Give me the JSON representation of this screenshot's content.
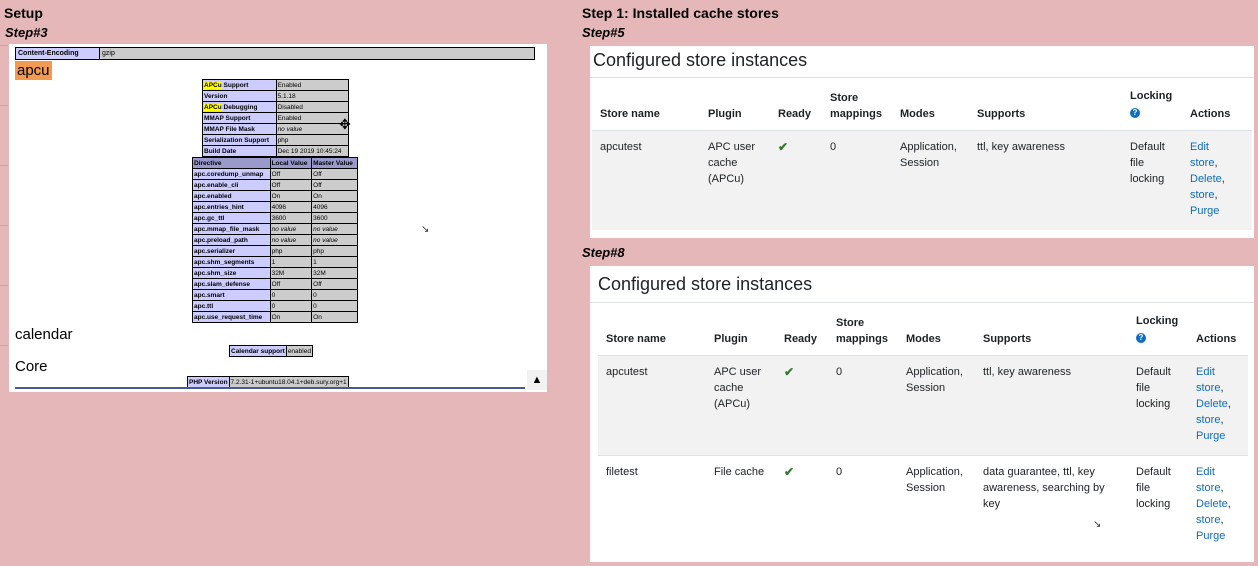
{
  "headings": {
    "setup": "Setup",
    "step1": "Step 1: Installed cache stores"
  },
  "steps": {
    "left": "Step#3",
    "right_top": "Step#5",
    "right_bottom": "Step#8"
  },
  "phpinfo": {
    "content_encoding": {
      "label": "Content-Encoding",
      "value": "gzip"
    },
    "apcu_title": "apcu",
    "apcu_info": [
      {
        "hl": "APCu",
        "rest": " Support",
        "value": "Enabled"
      },
      {
        "hl": "",
        "rest": "Version",
        "value": "5.1.18"
      },
      {
        "hl": "APCu",
        "rest": " Debugging",
        "value": "Disabled"
      },
      {
        "hl": "",
        "rest": "MMAP Support",
        "value": "Enabled"
      },
      {
        "hl": "",
        "rest": "MMAP File Mask",
        "value": "no value",
        "italic": true
      },
      {
        "hl": "",
        "rest": "Serialization Support",
        "value": "php"
      },
      {
        "hl": "",
        "rest": "Build Date",
        "value": "Dec 19 2019 10:45:24"
      }
    ],
    "directive_headers": [
      "Directive",
      "Local Value",
      "Master Value"
    ],
    "directives": [
      [
        "apc.coredump_unmap",
        "Off",
        "Off"
      ],
      [
        "apc.enable_cli",
        "Off",
        "Off"
      ],
      [
        "apc.enabled",
        "On",
        "On"
      ],
      [
        "apc.entries_hint",
        "4096",
        "4096"
      ],
      [
        "apc.gc_ttl",
        "3600",
        "3600"
      ],
      [
        "apc.mmap_file_mask",
        "no value",
        "no value"
      ],
      [
        "apc.preload_path",
        "no value",
        "no value"
      ],
      [
        "apc.serializer",
        "php",
        "php"
      ],
      [
        "apc.shm_segments",
        "1",
        "1"
      ],
      [
        "apc.shm_size",
        "32M",
        "32M"
      ],
      [
        "apc.slam_defense",
        "Off",
        "Off"
      ],
      [
        "apc.smart",
        "0",
        "0"
      ],
      [
        "apc.ttl",
        "0",
        "0"
      ],
      [
        "apc.use_request_time",
        "On",
        "On"
      ]
    ],
    "calendar_title": "calendar",
    "calendar_support": {
      "label": "Calendar support",
      "value": "enabled"
    },
    "core_title": "Core",
    "php_version": {
      "label": "PHP Version",
      "value": "7.2.31-1+ubuntu18.04.1+deb.sury.org+1"
    },
    "scroll_icon": "arrow-up-icon"
  },
  "stores_step5": {
    "title": "Configured store instances",
    "headers": {
      "store_name": "Store name",
      "plugin": "Plugin",
      "ready": "Ready",
      "mappings_1": "Store",
      "mappings_2": "mappings",
      "modes": "Modes",
      "supports": "Supports",
      "locking": "Locking",
      "actions": "Actions"
    },
    "rows": [
      {
        "name": "apcutest",
        "plugin": [
          "APC user",
          "cache",
          "(APCu)"
        ],
        "mappings": "0",
        "modes": [
          "Application,",
          "Session"
        ],
        "supports": [
          "ttl, key awareness"
        ],
        "locking": [
          "Default",
          "file",
          "locking"
        ],
        "actions": [
          "Edit",
          "store",
          "Delete",
          "store",
          "Purge"
        ]
      }
    ]
  },
  "stores_step8": {
    "title": "Configured store instances",
    "headers": {
      "store_name": "Store name",
      "plugin": "Plugin",
      "ready": "Ready",
      "mappings_1": "Store",
      "mappings_2": "mappings",
      "modes": "Modes",
      "supports": "Supports",
      "locking": "Locking",
      "actions": "Actions"
    },
    "rows": [
      {
        "name": "apcutest",
        "plugin": [
          "APC user",
          "cache",
          "(APCu)"
        ],
        "mappings": "0",
        "modes": [
          "Application,",
          "Session"
        ],
        "supports": [
          "ttl, key awareness"
        ],
        "locking": [
          "Default",
          "file",
          "locking"
        ],
        "actions": [
          "Edit",
          "store",
          "Delete",
          "store",
          "Purge"
        ]
      },
      {
        "name": "filetest",
        "plugin": [
          "File cache"
        ],
        "mappings": "0",
        "modes": [
          "Application,",
          "Session"
        ],
        "supports": [
          "data guarantee, ttl, key",
          "awareness, searching by",
          "key"
        ],
        "locking": [
          "Default",
          "file",
          "locking"
        ],
        "actions": [
          "Edit",
          "store",
          "Delete",
          "store",
          "Purge"
        ]
      }
    ]
  }
}
